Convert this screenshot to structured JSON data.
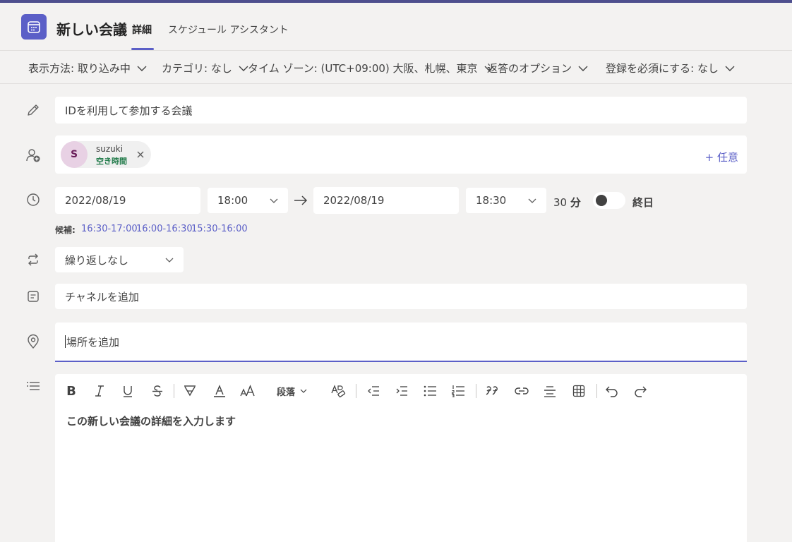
{
  "header": {
    "title": "新しい会議",
    "tabs": [
      {
        "label": "詳細",
        "active": true
      },
      {
        "label": "スケジュール アシスタント",
        "active": false
      }
    ]
  },
  "options": {
    "show_as": "表示方法: 取り込み中",
    "category": "カテゴリ: なし",
    "timezone": "タイム ゾーン: (UTC+09:00) 大阪、札幌、東京",
    "response": "返答のオプション",
    "registration": "登録を必須にする: なし"
  },
  "meeting": {
    "title_value": "IDを利用して参加する会議",
    "attendee": {
      "initial": "S",
      "name": "suzuki",
      "status": "空き時間"
    },
    "optional_label": "+ 任意",
    "start_date": "2022/08/19",
    "start_time": "18:00",
    "end_date": "2022/08/19",
    "end_time": "18:30",
    "duration_number": "30",
    "duration_unit": "分",
    "all_day_label": "終日",
    "all_day_on": false,
    "suggestions_label": "候補:",
    "suggestions": [
      "16:30-17:00",
      "16:00-16:30",
      "15:30-16:00"
    ],
    "repeat": "繰り返しなし",
    "channel_placeholder": "チャネルを追加",
    "location_placeholder": "場所を追加"
  },
  "editor": {
    "paragraph_label": "段落",
    "placeholder": "この新しい会議の詳細を入力します"
  },
  "colors": {
    "accent": "#5b5fc7",
    "top_bar": "#4e4f8e",
    "available_green": "#237b4b",
    "background": "#f3f2f1"
  }
}
